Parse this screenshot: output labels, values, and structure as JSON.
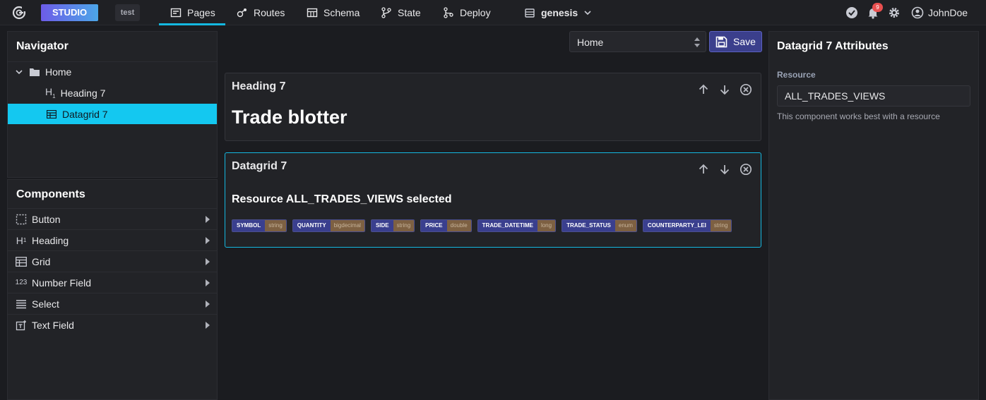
{
  "topbar": {
    "studio": "STUDIO",
    "env": "test",
    "tabs": [
      {
        "label": "Pages",
        "icon": "pages-icon",
        "active": true
      },
      {
        "label": "Routes",
        "icon": "routes-icon"
      },
      {
        "label": "Schema",
        "icon": "schema-icon"
      },
      {
        "label": "State",
        "icon": "state-icon"
      },
      {
        "label": "Deploy",
        "icon": "deploy-icon"
      }
    ],
    "project": "genesis",
    "notifications": "9",
    "user": "JohnDoe"
  },
  "navigator": {
    "title": "Navigator",
    "items": [
      {
        "label": "Home",
        "icon": "folder-icon"
      },
      {
        "label": "Heading 7",
        "icon": "heading-icon"
      },
      {
        "label": "Datagrid 7",
        "icon": "grid-icon",
        "selected": true
      }
    ]
  },
  "components": {
    "title": "Components",
    "items": [
      {
        "label": "Button",
        "icon": "button-icon"
      },
      {
        "label": "Heading",
        "icon": "heading-icon"
      },
      {
        "label": "Grid",
        "icon": "grid-icon"
      },
      {
        "label": "Number Field",
        "icon": "number-icon"
      },
      {
        "label": "Select",
        "icon": "select-icon"
      },
      {
        "label": "Text Field",
        "icon": "text-field-icon"
      }
    ]
  },
  "toolbar": {
    "page_select": "Home",
    "save_label": "Save"
  },
  "cards": {
    "heading": {
      "title": "Heading 7",
      "text": "Trade blotter"
    },
    "datagrid": {
      "title": "Datagrid 7",
      "resource_text": "Resource ALL_TRADES_VIEWS selected",
      "fields": [
        {
          "name": "SYMBOL",
          "type": "string"
        },
        {
          "name": "QUANTITY",
          "type": "bigdecimal"
        },
        {
          "name": "SIDE",
          "type": "string"
        },
        {
          "name": "PRICE",
          "type": "double"
        },
        {
          "name": "TRADE_DATETIME",
          "type": "long"
        },
        {
          "name": "TRADE_STATUS",
          "type": "enum"
        },
        {
          "name": "COUNTERPARTY_LEI",
          "type": "string"
        }
      ]
    }
  },
  "attributes": {
    "title": "Datagrid 7 Attributes",
    "resource_label": "Resource",
    "resource_value": "ALL_TRADES_VIEWS",
    "hint": "This component works best with a resource"
  },
  "colors": {
    "accent": "#14c8f0",
    "studio_gradient_start": "#6d5ce8",
    "save_bg": "#3b3f8c",
    "chip_name_bg": "#3a3f8e",
    "chip_type_bg": "#7d6042"
  }
}
